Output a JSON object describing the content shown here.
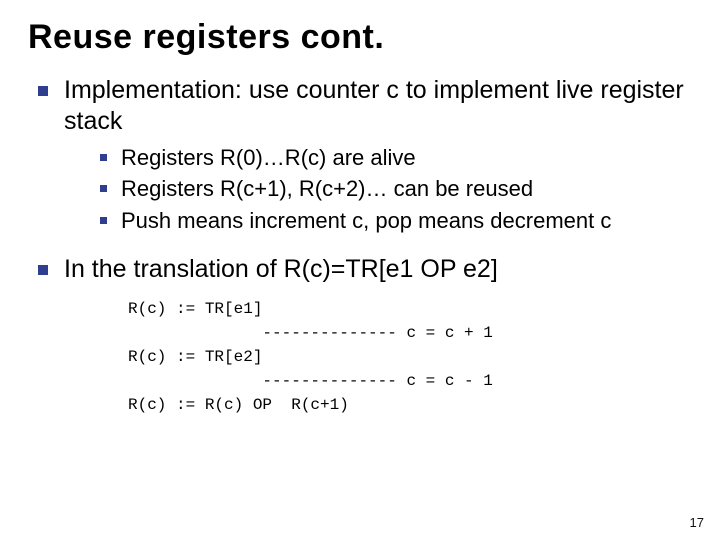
{
  "title": "Reuse registers cont.",
  "bullets": {
    "impl": "Implementation: use counter c to implement live register stack",
    "sub": {
      "alive": "Registers R(0)…R(c) are alive",
      "reused": "Registers R(c+1), R(c+2)… can be reused",
      "push": "Push means increment c, pop means decrement c"
    },
    "trans": "In the translation of R(c)=TR[e1 OP e2]"
  },
  "code": "R(c) := TR[e1]\n              -------------- c = c + 1\nR(c) := TR[e2]\n              -------------- c = c - 1\nR(c) := R(c) OP  R(c+1)",
  "pagenum": "17"
}
